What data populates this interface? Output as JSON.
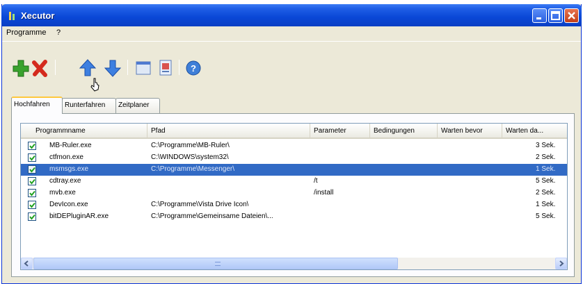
{
  "window": {
    "title": "Xecutor"
  },
  "menu": {
    "items": [
      "Programme",
      "?"
    ]
  },
  "toolbar": {
    "buttons": [
      "add-icon",
      "delete-icon",
      "move-up-icon",
      "move-down-icon",
      "window-icon",
      "edit-icon",
      "help-icon"
    ]
  },
  "tabs": [
    {
      "label": "Hochfahren",
      "active": true
    },
    {
      "label": "Runterfahren",
      "active": false
    },
    {
      "label": "Zeitplaner",
      "active": false
    }
  ],
  "list": {
    "columns": [
      "Programmname",
      "Pfad",
      "Parameter",
      "Bedingungen",
      "Warten bevor",
      "Warten da..."
    ],
    "rows": [
      {
        "checked": true,
        "name": "MB-Ruler.exe",
        "path": "C:\\Programme\\MB-Ruler\\",
        "param": "",
        "cond": "",
        "before": "",
        "after": "3 Sek."
      },
      {
        "checked": true,
        "name": "ctfmon.exe",
        "path": "C:\\WINDOWS\\system32\\",
        "param": "",
        "cond": "",
        "before": "",
        "after": "2 Sek."
      },
      {
        "checked": true,
        "name": "msmsgs.exe",
        "path": "C:\\Programme\\Messenger\\",
        "param": "",
        "cond": "",
        "before": "",
        "after": "1 Sek.",
        "selected": true
      },
      {
        "checked": true,
        "name": "cdtray.exe",
        "path": "",
        "param": "/t",
        "cond": "",
        "before": "",
        "after": "5 Sek."
      },
      {
        "checked": true,
        "name": "mvb.exe",
        "path": "",
        "param": "/install",
        "cond": "",
        "before": "",
        "after": "2 Sek."
      },
      {
        "checked": true,
        "name": "DevIcon.exe",
        "path": "C:\\Programme\\Vista Drive Icon\\",
        "param": "",
        "cond": "",
        "before": "",
        "after": "1 Sek."
      },
      {
        "checked": true,
        "name": "bitDEPluginAR.exe",
        "path": "C:\\Programme\\Gemeinsame Dateien\\...",
        "param": "",
        "cond": "",
        "before": "",
        "after": "5 Sek."
      }
    ]
  },
  "colors": {
    "titlebar": "#0a47d6",
    "selection": "#316ac5",
    "tab_highlight": "#ffc83c"
  }
}
